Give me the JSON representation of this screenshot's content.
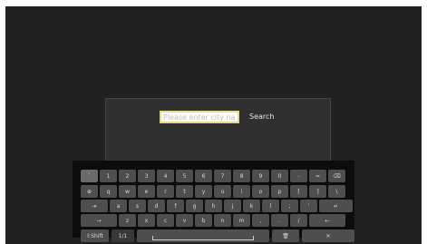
{
  "search": {
    "placeholder": "Please enter city name",
    "button_label": "Search"
  },
  "keyboard": {
    "row1": [
      "`",
      "1",
      "2",
      "3",
      "4",
      "5",
      "6",
      "7",
      "8",
      "9",
      "0",
      "-",
      "=",
      "⌫"
    ],
    "row2": [
      "⊕",
      "q",
      "w",
      "e",
      "r",
      "t",
      "y",
      "u",
      "i",
      "o",
      "p",
      "[",
      "]",
      "\\"
    ],
    "row3": [
      "⇥",
      "a",
      "s",
      "d",
      "f",
      "g",
      "h",
      "j",
      "k",
      "l",
      ";",
      "'",
      "↵"
    ],
    "row4": [
      "→",
      "z",
      "x",
      "c",
      "v",
      "b",
      "n",
      "m",
      ",",
      ".",
      "/",
      "←"
    ],
    "row5": [
      "⇧Shift",
      "1/1",
      "",
      "🗑",
      "✕"
    ]
  },
  "colors": {
    "screen_bg": "#212121",
    "panel_bg": "#303030",
    "keyboard_bg": "#0c0c0c",
    "key_bg": "#4e4e4e",
    "input_border": "#e8d88c"
  }
}
